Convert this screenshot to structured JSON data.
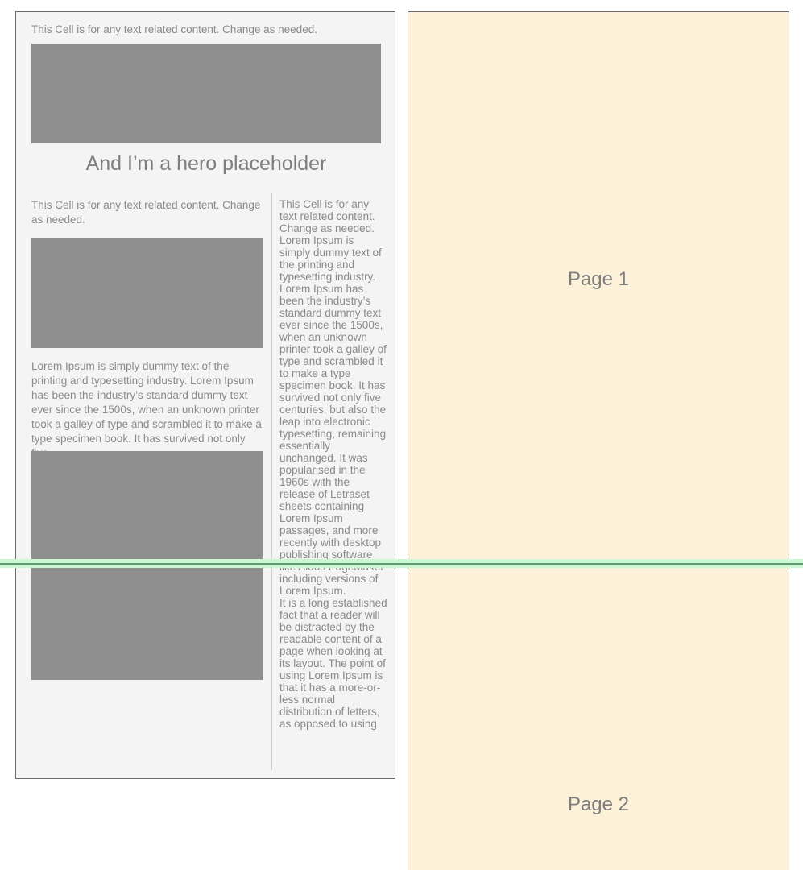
{
  "editor": {
    "top_cell_text": "This Cell is for any text related content. Change as needed.",
    "hero_image_label": "hero-image-placeholder",
    "hero_title": "And I’m a hero placeholder",
    "left_column": {
      "cell_text": "This Cell is for any text related content. Change as needed.",
      "image_1_label": "image-placeholder",
      "lorem_text": "Lorem Ipsum is simply dummy text of the printing and typesetting industry. Lorem Ipsum has been the industry’s standard dummy text ever since the 1500s, when an unknown printer took a galley of type and scrambled it to make a type specimen book. It has survived not only five",
      "image_2_label": "image-placeholder"
    },
    "right_column": {
      "text": "This Cell is for any text related content. Change as needed. Lorem Ipsum is simply dummy text of the printing and typesetting industry. Lorem Ipsum has been the industry’s standard dummy text ever since the 1500s, when an unknown printer took a galley of type and scrambled it to make a type specimen book. It has survived not only five centuries, but also the leap into electronic typesetting, remaining essentially unchanged. It was popularised in the 1960s with the release of Letraset sheets containing Lorem Ipsum passages, and more recently with desktop publishing software like Aldus PageMaker including versions of Lorem Ipsum.\nIt is a long established fact that a reader will be distracted by the readable content of a page when looking at its layout. The point of using Lorem Ipsum is that it has a more-or-less normal distribution of letters, as opposed to using"
    }
  },
  "preview": {
    "page_1_label": "Page 1",
    "page_2_label": "Page 2"
  },
  "guides": {
    "page_break_label": "page-break-guide"
  },
  "colors": {
    "panel_background": "#f4f4f4",
    "panel_border": "#6b6b6b",
    "placeholder_gray": "#8f8f8f",
    "page_cream": "#fdf2d9",
    "text_gray": "#8a8a8a",
    "heading_gray": "#7e7e7e",
    "page_break_green": "#5e9e6e",
    "page_break_green_halo": "#ccf6d4",
    "column_divider": "#cfcfcf"
  }
}
